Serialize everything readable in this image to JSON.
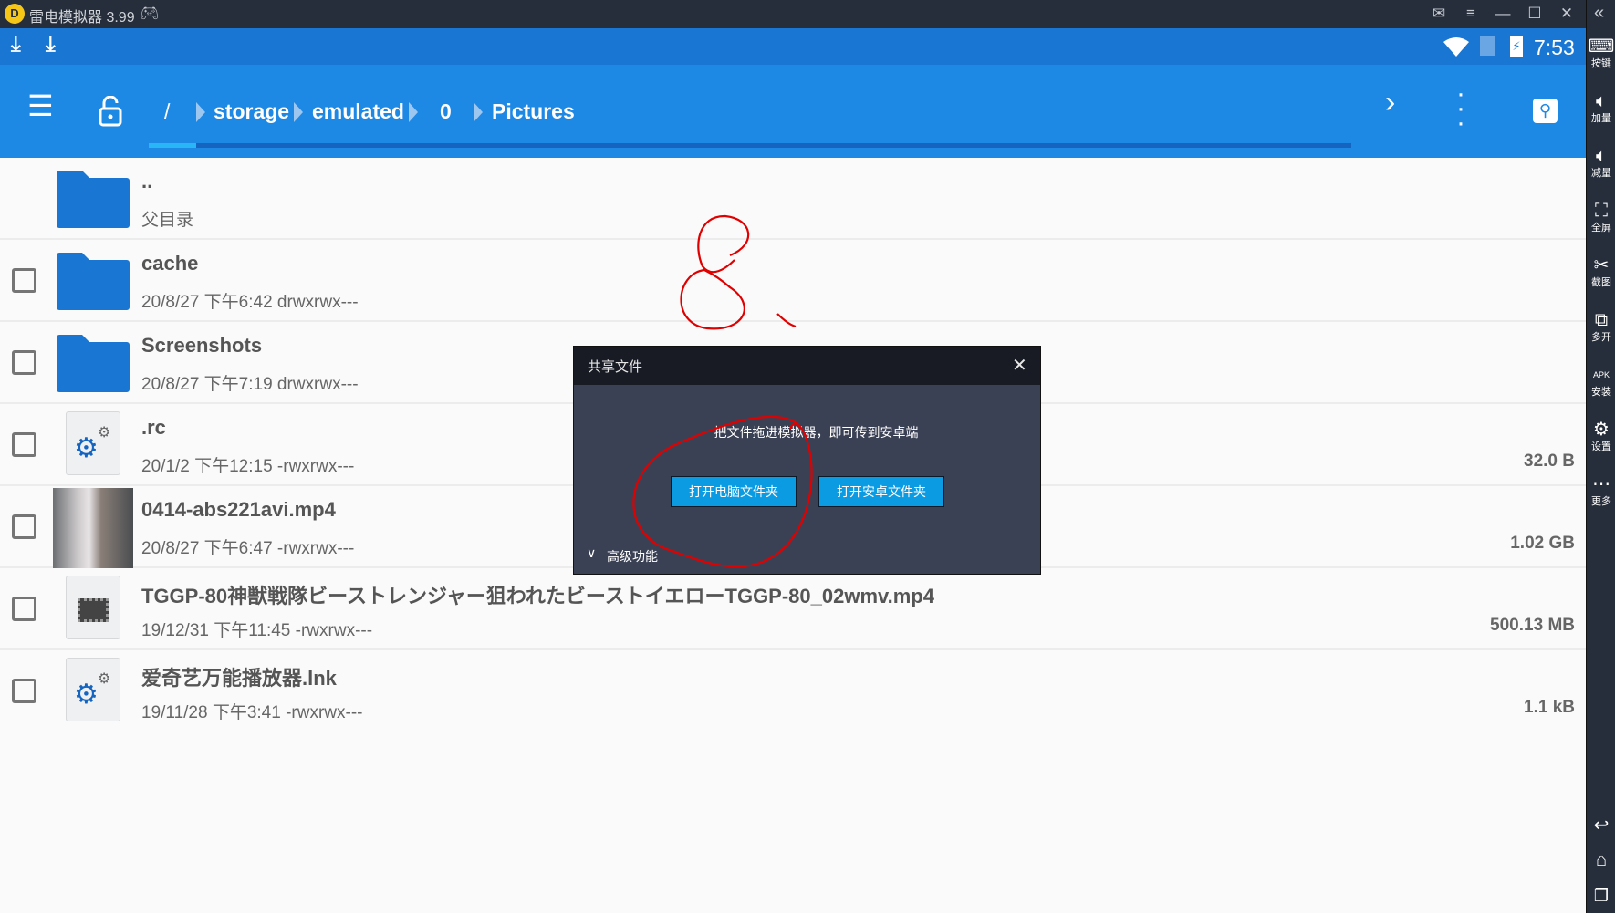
{
  "window": {
    "title": "雷电模拟器 3.99"
  },
  "statusbar": {
    "time": "7:53"
  },
  "breadcrumb": [
    "/",
    "storage",
    "emulated",
    "0",
    "Pictures"
  ],
  "files": [
    {
      "name": "..",
      "meta": "父目录",
      "size": "",
      "type": "parent"
    },
    {
      "name": "cache",
      "meta": "20/8/27 下午6:42   drwxrwx---",
      "size": "",
      "type": "folder"
    },
    {
      "name": "Screenshots",
      "meta": "20/8/27 下午7:19   drwxrwx---",
      "size": "",
      "type": "folder"
    },
    {
      "name": ".rc",
      "meta": "20/1/2 下午12:15   -rwxrwx---",
      "size": "32.0 B",
      "type": "settings"
    },
    {
      "name": "0414-abs221avi.mp4",
      "meta": "20/8/27 下午6:47   -rwxrwx---",
      "size": "1.02 GB",
      "type": "video-thumb"
    },
    {
      "name": "TGGP-80神獣戦隊ビーストレンジャー狙われたビーストイエローTGGP-80_02wmv.mp4",
      "meta": "19/12/31 下午11:45   -rwxrwx---",
      "size": "500.13 MB",
      "type": "video"
    },
    {
      "name": "爱奇艺万能播放器.lnk",
      "meta": "19/11/28 下午3:41   -rwxrwx---",
      "size": "1.1 kB",
      "type": "settings"
    }
  ],
  "dialog": {
    "title": "共享文件",
    "message": "把文件拖进模拟器，即可传到安卓端",
    "btn_pc": "打开电脑文件夹",
    "btn_android": "打开安卓文件夹",
    "advanced": "高级功能"
  },
  "sidebar": [
    {
      "label": "按键",
      "icon": "keyboard-icon"
    },
    {
      "label": "加量",
      "icon": "volume-up-icon"
    },
    {
      "label": "减量",
      "icon": "volume-down-icon"
    },
    {
      "label": "全屏",
      "icon": "fullscreen-icon"
    },
    {
      "label": "截图",
      "icon": "scissors-icon"
    },
    {
      "label": "多开",
      "icon": "multi-instance-icon"
    },
    {
      "label": "安装",
      "icon": "apk-install-icon"
    },
    {
      "label": "设置",
      "icon": "gear-icon"
    },
    {
      "label": "更多",
      "icon": "more-icon"
    }
  ],
  "colors": {
    "appbar": "#1e88e5",
    "statusbar": "#1976d2",
    "frame": "#272e3b",
    "dialog_btn": "#0a9be2",
    "annotation": "#e00000"
  }
}
